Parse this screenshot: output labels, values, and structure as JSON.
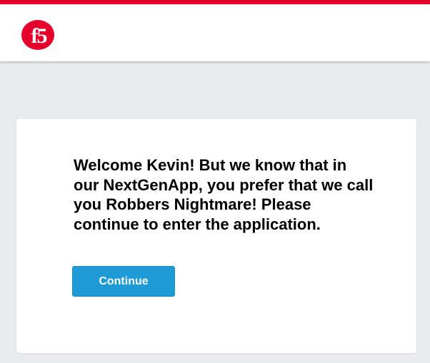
{
  "brand": {
    "logo_text": "f5",
    "logo_color": "#e4002b",
    "strip_color": "#e4002b"
  },
  "main": {
    "message": "Welcome Kevin! But we know that in our NextGenApp, you prefer that we call you Robbers Nightmare! Please continue to enter the application.",
    "continue_label": "Continue",
    "button_color": "#1e9ad6"
  }
}
